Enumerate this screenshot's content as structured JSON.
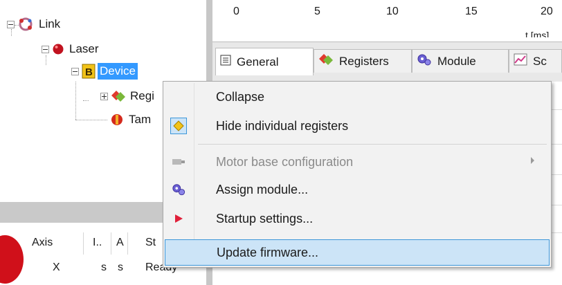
{
  "tree": {
    "items": [
      {
        "label": "Link"
      },
      {
        "label": "Laser"
      },
      {
        "label": "Device"
      },
      {
        "label": "Regi"
      },
      {
        "label": "Tam"
      }
    ]
  },
  "timeaxis": {
    "ticks": [
      "0",
      "5",
      "10",
      "15",
      "20"
    ],
    "unit_label": "t [ms]"
  },
  "tabs": [
    {
      "label": "General"
    },
    {
      "label": "Registers"
    },
    {
      "label": "Module"
    },
    {
      "label": "Sc"
    }
  ],
  "bottom_grid": {
    "headers": [
      "Axis",
      "I..",
      "A",
      "St"
    ],
    "row": [
      "X",
      "s",
      "s",
      "Ready"
    ]
  },
  "context_menu": {
    "items": [
      {
        "label": "Collapse"
      },
      {
        "label": "Hide individual registers",
        "checked": true
      },
      {
        "label": "Motor base configuration",
        "disabled": true,
        "submenu": true
      },
      {
        "label": "Assign module..."
      },
      {
        "label": "Startup settings..."
      },
      {
        "label": "Update firmware...",
        "highlighted": true
      }
    ]
  },
  "colors": {
    "selection": "#3399ff",
    "menu_highlight": "#cce4f7",
    "menu_highlight_border": "#3b96d9"
  }
}
